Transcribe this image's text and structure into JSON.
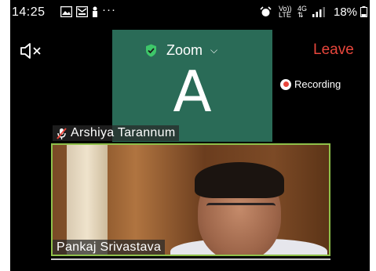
{
  "status_bar": {
    "time": "14:25",
    "dots": "···",
    "network_top": "Vo))",
    "network_bottom": "LTE",
    "data_top": "4G",
    "data_bottom": "⇅",
    "battery": "18%"
  },
  "meeting": {
    "title": "Zoom",
    "leave_label": "Leave",
    "recording_label": "Recording"
  },
  "participants": [
    {
      "name": "Arshiya Tarannum",
      "avatar_letter": "A",
      "muted": true
    },
    {
      "name": "Pankaj Srivastava",
      "active_speaker": true
    }
  ],
  "colors": {
    "leave": "#e8463c",
    "avatar_bg": "#2a6b57",
    "active_border": "#8fc04a",
    "shield": "#3ec76a"
  },
  "icons": [
    "speaker-muted-icon",
    "shield-check-icon",
    "chevron-down-icon",
    "mic-muted-icon",
    "record-icon",
    "gallery-icon",
    "alarm-icon",
    "battery-icon"
  ]
}
